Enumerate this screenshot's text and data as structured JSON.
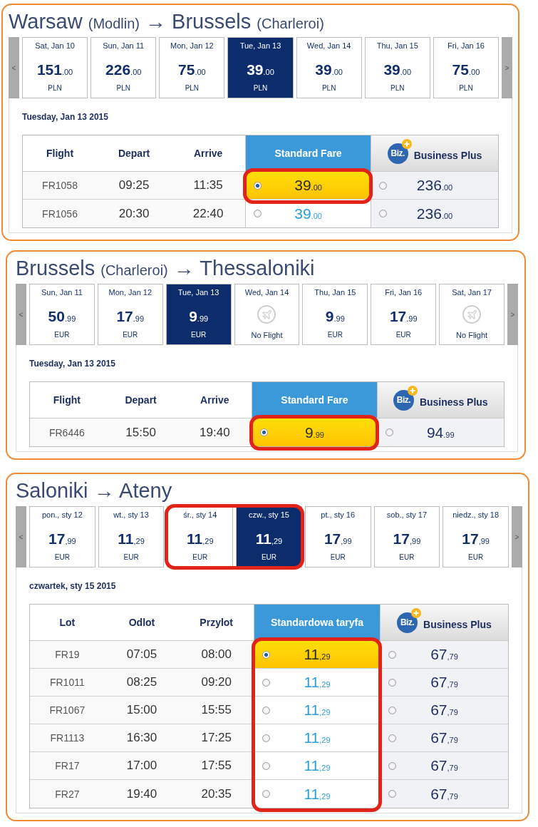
{
  "routes": [
    {
      "title": {
        "origin": "Warsaw",
        "origin_airport": "(Modlin)",
        "arrow": "→",
        "destination": "Brussels",
        "destination_airport": "(Charleroi)"
      },
      "carousel": {
        "prev": "<",
        "next": ">",
        "dates": [
          {
            "label": "Sat, Jan 10",
            "kind": "fare",
            "amount": "151",
            "fraction": ".00",
            "currency": "PLN",
            "selected": false,
            "circled": false
          },
          {
            "label": "Sun, Jan 11",
            "kind": "fare",
            "amount": "226",
            "fraction": ".00",
            "currency": "PLN",
            "selected": false,
            "circled": false
          },
          {
            "label": "Mon, Jan 12",
            "kind": "fare",
            "amount": "75",
            "fraction": ".00",
            "currency": "PLN",
            "selected": false,
            "circled": false
          },
          {
            "label": "Tue, Jan 13",
            "kind": "fare",
            "amount": "39",
            "fraction": ".00",
            "currency": "PLN",
            "selected": true,
            "circled": false
          },
          {
            "label": "Wed, Jan 14",
            "kind": "fare",
            "amount": "39",
            "fraction": ".00",
            "currency": "PLN",
            "selected": false,
            "circled": false
          },
          {
            "label": "Thu, Jan 15",
            "kind": "fare",
            "amount": "39",
            "fraction": ".00",
            "currency": "PLN",
            "selected": false,
            "circled": false
          },
          {
            "label": "Fri, Jan 16",
            "kind": "fare",
            "amount": "75",
            "fraction": ".00",
            "currency": "PLN",
            "selected": false,
            "circled": false
          }
        ]
      },
      "date_heading": "Tuesday, Jan 13 2015",
      "table": {
        "columns": [
          {
            "label": "Flight",
            "kind": "plain"
          },
          {
            "label": "Depart",
            "kind": "plain"
          },
          {
            "label": "Arrive",
            "kind": "plain"
          },
          {
            "label": "Standard Fare",
            "kind": "standard"
          },
          {
            "label": "Business Plus",
            "kind": "business",
            "logo": "Biz."
          }
        ],
        "rows": [
          {
            "flight": "FR1058",
            "depart": "09:25",
            "arrive": "11:35",
            "standard": {
              "amount": "39",
              "fraction": ".00",
              "selected": true,
              "circled": true
            },
            "business": {
              "amount": "236",
              "fraction": ".00",
              "selected": false
            }
          },
          {
            "flight": "FR1056",
            "depart": "20:30",
            "arrive": "22:40",
            "standard": {
              "amount": "39",
              "fraction": ".00",
              "selected": false,
              "circled": false
            },
            "business": {
              "amount": "236",
              "fraction": ".00",
              "selected": false
            }
          }
        ]
      }
    },
    {
      "title": {
        "origin": "Brussels",
        "origin_airport": "(Charleroi)",
        "arrow": "→",
        "destination": "Thessaloniki"
      },
      "carousel": {
        "prev": "<",
        "next": ">",
        "dates": [
          {
            "label": "Sun, Jan 11",
            "kind": "fare",
            "amount": "50",
            "fraction": ".99",
            "currency": "EUR",
            "selected": false,
            "circled": false
          },
          {
            "label": "Mon, Jan 12",
            "kind": "fare",
            "amount": "17",
            "fraction": ".99",
            "currency": "EUR",
            "selected": false,
            "circled": false
          },
          {
            "label": "Tue, Jan 13",
            "kind": "fare",
            "amount": "9",
            "fraction": ".99",
            "currency": "EUR",
            "selected": true,
            "circled": false
          },
          {
            "label": "Wed, Jan 14",
            "kind": "no_flight",
            "note": "No Flight",
            "selected": false,
            "circled": false
          },
          {
            "label": "Thu, Jan 15",
            "kind": "fare",
            "amount": "9",
            "fraction": ".99",
            "currency": "EUR",
            "selected": false,
            "circled": false
          },
          {
            "label": "Fri, Jan 16",
            "kind": "fare",
            "amount": "17",
            "fraction": ".99",
            "currency": "EUR",
            "selected": false,
            "circled": false
          },
          {
            "label": "Sat, Jan 17",
            "kind": "no_flight",
            "note": "No Flight",
            "selected": false,
            "circled": false
          }
        ]
      },
      "date_heading": "Tuesday, Jan 13 2015",
      "table": {
        "columns": [
          {
            "label": "Flight",
            "kind": "plain"
          },
          {
            "label": "Depart",
            "kind": "plain"
          },
          {
            "label": "Arrive",
            "kind": "plain"
          },
          {
            "label": "Standard Fare",
            "kind": "standard"
          },
          {
            "label": "Business Plus",
            "kind": "business",
            "logo": "Biz."
          }
        ],
        "rows": [
          {
            "flight": "FR6446",
            "depart": "15:50",
            "arrive": "19:40",
            "standard": {
              "amount": "9",
              "fraction": ".99",
              "selected": true,
              "circled": true
            },
            "business": {
              "amount": "94",
              "fraction": ".99",
              "selected": false
            }
          }
        ]
      }
    },
    {
      "title": {
        "origin": "Saloniki",
        "arrow": "→",
        "destination": "Ateny"
      },
      "carousel": {
        "prev": "<",
        "next": ">",
        "dates": [
          {
            "label": "pon., sty 12",
            "kind": "fare",
            "amount": "17",
            "fraction": ",99",
            "currency": "EUR",
            "selected": false,
            "circled": false
          },
          {
            "label": "wt., sty 13",
            "kind": "fare",
            "amount": "11",
            "fraction": ",29",
            "currency": "EUR",
            "selected": false,
            "circled": false
          },
          {
            "label": "śr., sty 14",
            "kind": "fare",
            "amount": "11",
            "fraction": ",29",
            "currency": "EUR",
            "selected": false,
            "circled": true
          },
          {
            "label": "czw., sty 15",
            "kind": "fare",
            "amount": "11",
            "fraction": ",29",
            "currency": "EUR",
            "selected": true,
            "circled": true
          },
          {
            "label": "pt., sty 16",
            "kind": "fare",
            "amount": "17",
            "fraction": ",99",
            "currency": "EUR",
            "selected": false,
            "circled": false
          },
          {
            "label": "sob., sty 17",
            "kind": "fare",
            "amount": "17",
            "fraction": ",99",
            "currency": "EUR",
            "selected": false,
            "circled": false
          },
          {
            "label": "niedz., sty 18",
            "kind": "fare",
            "amount": "17",
            "fraction": ",99",
            "currency": "EUR",
            "selected": false,
            "circled": false
          }
        ]
      },
      "date_heading": "czwartek, sty 15 2015",
      "table": {
        "columns": [
          {
            "label": "Lot",
            "kind": "plain"
          },
          {
            "label": "Odlot",
            "kind": "plain"
          },
          {
            "label": "Przylot",
            "kind": "plain"
          },
          {
            "label": "Standardowa taryfa",
            "kind": "standard"
          },
          {
            "label": "Business Plus",
            "kind": "business",
            "logo": "Biz."
          }
        ],
        "rows": [
          {
            "flight": "FR19",
            "depart": "07:05",
            "arrive": "08:00",
            "standard": {
              "amount": "11",
              "fraction": ",29",
              "selected": true,
              "circled": true
            },
            "business": {
              "amount": "67",
              "fraction": ",79",
              "selected": false
            }
          },
          {
            "flight": "FR1011",
            "depart": "08:25",
            "arrive": "09:20",
            "standard": {
              "amount": "11",
              "fraction": ",29",
              "selected": false,
              "circled": true
            },
            "business": {
              "amount": "67",
              "fraction": ",79",
              "selected": false
            }
          },
          {
            "flight": "FR1067",
            "depart": "15:00",
            "arrive": "15:55",
            "standard": {
              "amount": "11",
              "fraction": ",29",
              "selected": false,
              "circled": true
            },
            "business": {
              "amount": "67",
              "fraction": ",79",
              "selected": false
            }
          },
          {
            "flight": "FR1113",
            "depart": "16:30",
            "arrive": "17:25",
            "standard": {
              "amount": "11",
              "fraction": ",29",
              "selected": false,
              "circled": true
            },
            "business": {
              "amount": "67",
              "fraction": ",79",
              "selected": false
            }
          },
          {
            "flight": "FR17",
            "depart": "17:00",
            "arrive": "17:55",
            "standard": {
              "amount": "11",
              "fraction": ",29",
              "selected": false,
              "circled": true
            },
            "business": {
              "amount": "67",
              "fraction": ",79",
              "selected": false
            }
          },
          {
            "flight": "FR27",
            "depart": "19:40",
            "arrive": "20:35",
            "standard": {
              "amount": "11",
              "fraction": ",29",
              "selected": false,
              "circled": true
            },
            "business": {
              "amount": "67",
              "fraction": ",79",
              "selected": false
            }
          }
        ]
      }
    }
  ]
}
